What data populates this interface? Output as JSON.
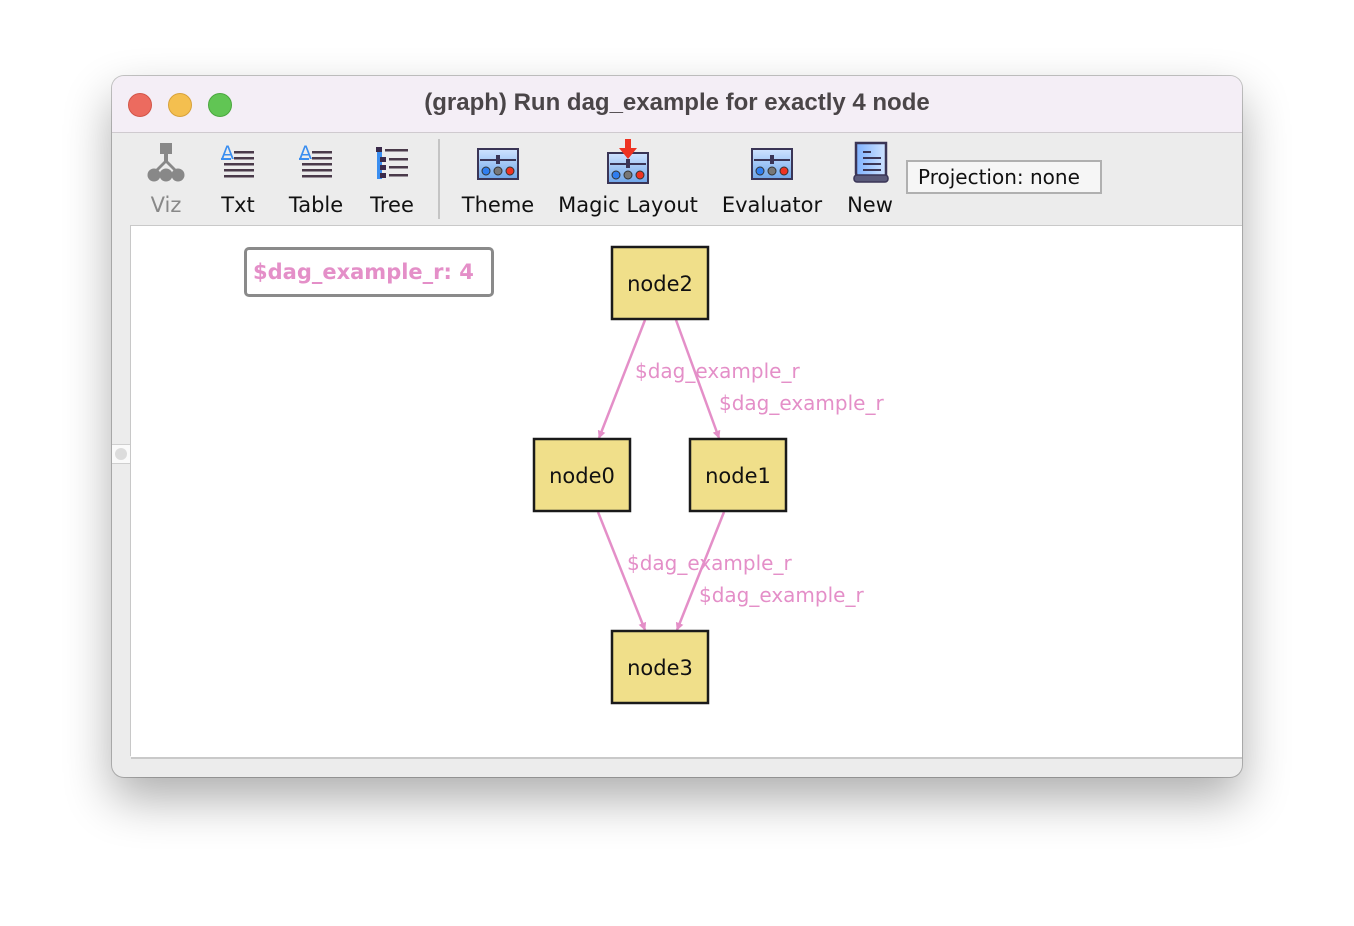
{
  "window": {
    "title": "(graph) Run dag_example for exactly 4 node",
    "controls": [
      "close",
      "minimize",
      "maximize"
    ]
  },
  "toolbar": {
    "buttons": [
      {
        "label": "Viz",
        "icon": "graph-tree-icon",
        "enabled": false
      },
      {
        "label": "Txt",
        "icon": "text-icon",
        "enabled": true
      },
      {
        "label": "Table",
        "icon": "table-icon",
        "enabled": true
      },
      {
        "label": "Tree",
        "icon": "tree-list-icon",
        "enabled": true
      },
      {
        "label": "Theme",
        "icon": "theme-sliders-icon",
        "enabled": true
      },
      {
        "label": "Magic Layout",
        "icon": "magic-layout-icon",
        "enabled": true
      },
      {
        "label": "Evaluator",
        "icon": "evaluator-sliders-icon",
        "enabled": true
      },
      {
        "label": "New",
        "icon": "scroll-document-icon",
        "enabled": true
      }
    ],
    "projection": "Projection: none"
  },
  "graph": {
    "legend": "$dag_example_r: 4",
    "node_fill": "#f0df8a",
    "edge_color": "#e48fc8",
    "nodes": [
      {
        "id": "node2",
        "label": "node2"
      },
      {
        "id": "node0",
        "label": "node0"
      },
      {
        "id": "node1",
        "label": "node1"
      },
      {
        "id": "node3",
        "label": "node3"
      }
    ],
    "edges": [
      {
        "from": "node2",
        "to": "node0",
        "label": "$dag_example_r"
      },
      {
        "from": "node2",
        "to": "node1",
        "label": "$dag_example_r"
      },
      {
        "from": "node0",
        "to": "node3",
        "label": "$dag_example_r"
      },
      {
        "from": "node1",
        "to": "node3",
        "label": "$dag_example_r"
      }
    ]
  }
}
